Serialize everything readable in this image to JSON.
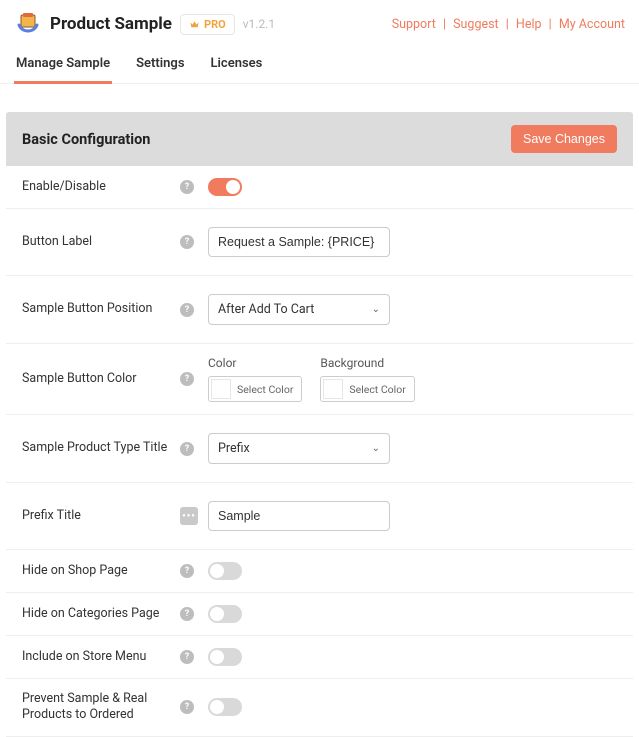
{
  "header": {
    "product_title": "Product Sample",
    "badge": "PRO",
    "version": "v1.2.1",
    "links": [
      "Support",
      "Suggest",
      "Help",
      "My Account"
    ]
  },
  "tabs": [
    {
      "label": "Manage Sample",
      "active": true
    },
    {
      "label": "Settings",
      "active": false
    },
    {
      "label": "Licenses",
      "active": false
    }
  ],
  "section": {
    "title": "Basic Configuration",
    "save_label": "Save Changes"
  },
  "rows": {
    "enable": {
      "label": "Enable/Disable",
      "value": true
    },
    "button_label": {
      "label": "Button Label",
      "value": "Request a Sample: {PRICE}"
    },
    "position": {
      "label": "Sample Button Position",
      "value": "After Add To Cart"
    },
    "color": {
      "label": "Sample Button Color",
      "color_heading": "Color",
      "background_heading": "Background",
      "select_color_text": "Select Color"
    },
    "type_title": {
      "label": "Sample Product Type Title",
      "value": "Prefix"
    },
    "prefix_title": {
      "label": "Prefix Title",
      "value": "Sample"
    },
    "hide_shop": {
      "label": "Hide on Shop Page",
      "value": false
    },
    "hide_cat": {
      "label": "Hide on Categories Page",
      "value": false
    },
    "store_menu": {
      "label": "Include on Store Menu",
      "value": false
    },
    "prevent": {
      "label": "Prevent Sample & Real Products to Ordered",
      "value": false
    }
  }
}
